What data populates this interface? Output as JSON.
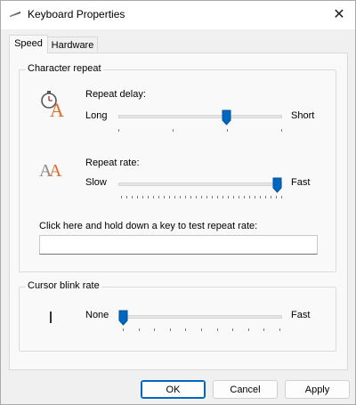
{
  "window": {
    "title": "Keyboard Properties",
    "icon": "keyboard-icon",
    "close_glyph": "✕"
  },
  "tabs": [
    {
      "label": "Speed",
      "active": true
    },
    {
      "label": "Hardware",
      "active": false
    }
  ],
  "character_repeat": {
    "legend": "Character repeat",
    "repeat_delay": {
      "label": "Repeat delay:",
      "min_label": "Long",
      "max_label": "Short",
      "value_fraction": 0.667,
      "icon": "repeat-delay-stopwatch-icon"
    },
    "repeat_rate": {
      "label": "Repeat rate:",
      "min_label": "Slow",
      "max_label": "Fast",
      "value_fraction": 1.0,
      "icon": "repeat-rate-letters-icon"
    },
    "test_label": "Click here and hold down a key to test repeat rate:",
    "test_value": ""
  },
  "cursor_blink": {
    "legend": "Cursor blink rate",
    "min_label": "None",
    "max_label": "Fast",
    "value_fraction": 0.0,
    "icon": "text-cursor-icon"
  },
  "buttons": {
    "ok": "OK",
    "cancel": "Cancel",
    "apply": "Apply"
  },
  "colors": {
    "accent": "#0067c0",
    "icon_orange": "#e36b2c"
  }
}
